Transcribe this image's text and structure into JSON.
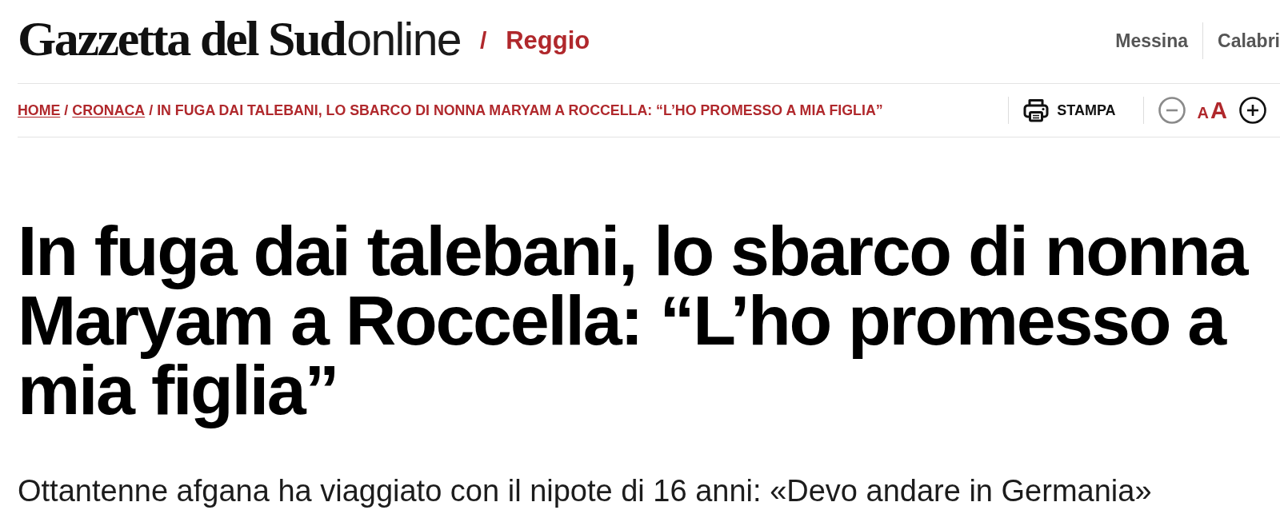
{
  "header": {
    "logo": {
      "title": "Gazzetta del Sud",
      "suffix": "online"
    },
    "separator": "/",
    "section": "Reggio",
    "nav": [
      {
        "label": "Messina"
      },
      {
        "label": "Calabri"
      }
    ]
  },
  "breadcrumb": {
    "separator": "/",
    "items": [
      {
        "label": "HOME",
        "kind": "link"
      },
      {
        "label": "CRONACA",
        "kind": "link"
      },
      {
        "label": "IN FUGA DAI TALEBANI, LO SBARCO DI NONNA MARYAM A ROCCELLA: “L’HO PROMESSO A MIA FIGLIA”",
        "kind": "current"
      }
    ]
  },
  "toolbar": {
    "print": {
      "label": "STAMPA"
    },
    "font_size": {
      "decrease": {
        "disabled": true
      },
      "glyphs": [
        {
          "text": "A",
          "kind": "small"
        },
        {
          "text": "A",
          "kind": "large"
        }
      ],
      "increase": {
        "disabled": false
      }
    }
  },
  "article": {
    "headline": "In fuga dai talebani, lo sbarco di nonna Maryam a Roccella: “L’ho promesso a mia figlia”",
    "summary": "Ottantenne afgana ha viaggiato con il nipote di 16 anni: «Devo andare in Germania»"
  }
}
